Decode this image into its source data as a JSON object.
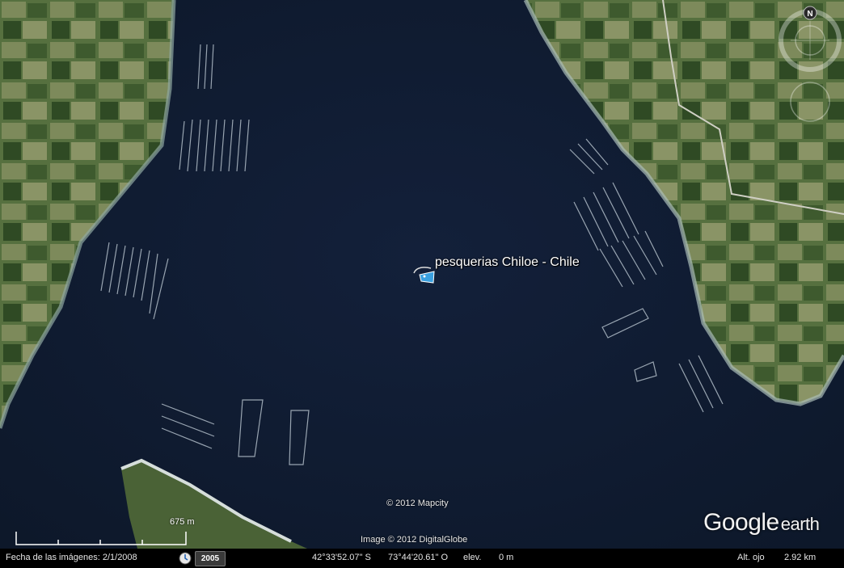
{
  "placemark": {
    "label": "pesquerias Chiloe - Chile",
    "icon": "fish-hook-placemark-icon"
  },
  "attribution": {
    "mapcity": "© 2012 Mapcity",
    "imagery": "Image © 2012 DigitalGlobe"
  },
  "brand": {
    "google": "Google",
    "earth": "earth"
  },
  "scale": {
    "label": "675 m"
  },
  "compass": {
    "north_label": "N"
  },
  "status": {
    "imagery_date_label": "Fecha de las imágenes: 2/1/2008",
    "history_icon": "clock-icon",
    "history_year": "2005",
    "latitude": "42°33'52.07\" S",
    "longitude": "73°44'20.61\" O",
    "elev_label": "elev.",
    "elev_value": "0 m",
    "eye_alt_label": "Alt. ojo",
    "eye_alt_value": "2.92 km"
  },
  "colors": {
    "water": "#111d30",
    "land": "#4f6a3a",
    "shore": "#c9d4cc",
    "status_bg": "#000000"
  }
}
